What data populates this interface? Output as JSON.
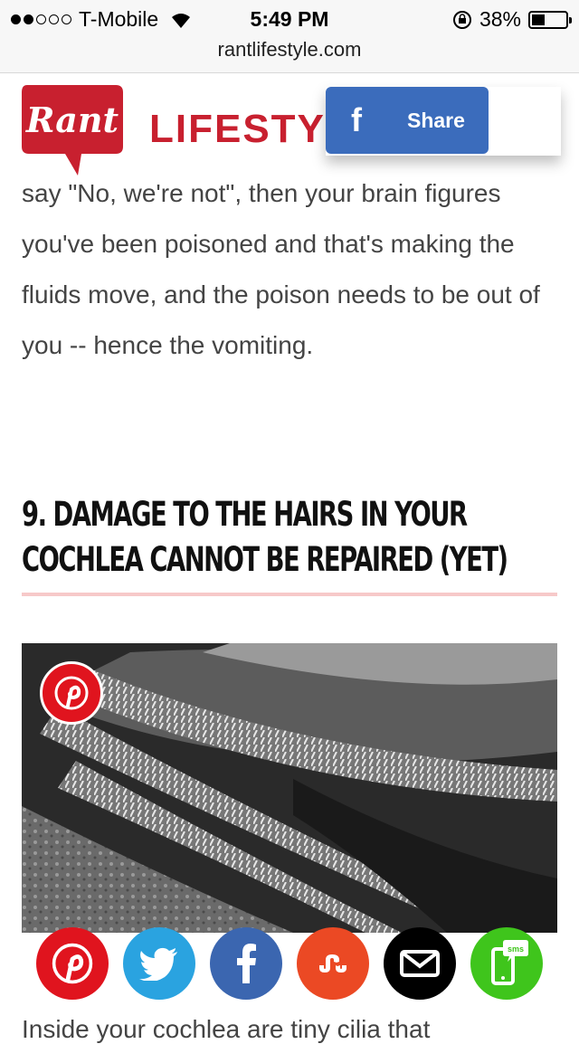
{
  "status_bar": {
    "carrier": "T-Mobile",
    "time": "5:49 PM",
    "battery": "38%",
    "battery_level": 0.38,
    "signal_bars_filled": 2,
    "signal_bars_total": 5
  },
  "browser": {
    "url": "rantlifestyle.com"
  },
  "site_header": {
    "logo_bubble_text": "Rant",
    "logo_word": "LIFESTYLE",
    "brand_color": "#c8202f"
  },
  "share_button": {
    "label": "Share",
    "icon": "facebook-f-icon",
    "color": "#3b6cbc"
  },
  "article": {
    "paragraph": "say \"No, we're not\", then your brain figures you've been poisoned and that's making the fluids move, and the poison needs to be out of you -- hence the vomiting.",
    "heading": "9. DAMAGE TO THE HAIRS IN YOUR COCHLEA CANNOT BE REPAIRED (YET)",
    "image_icon": "pinterest-icon",
    "next_line_partial": "Inside your cochlea are tiny cilia that"
  },
  "social_buttons": [
    {
      "name": "pinterest",
      "icon": "pinterest-icon",
      "color": "#e0141e"
    },
    {
      "name": "twitter",
      "icon": "twitter-icon",
      "color": "#2aa3e0"
    },
    {
      "name": "facebook",
      "icon": "facebook-icon",
      "color": "#3b66b0"
    },
    {
      "name": "stumbleupon",
      "icon": "stumbleupon-icon",
      "color": "#eb4924"
    },
    {
      "name": "email",
      "icon": "mail-icon",
      "color": "#000000"
    },
    {
      "name": "sms",
      "icon": "sms-icon",
      "color": "#3fc51c",
      "label": "sms"
    }
  ]
}
